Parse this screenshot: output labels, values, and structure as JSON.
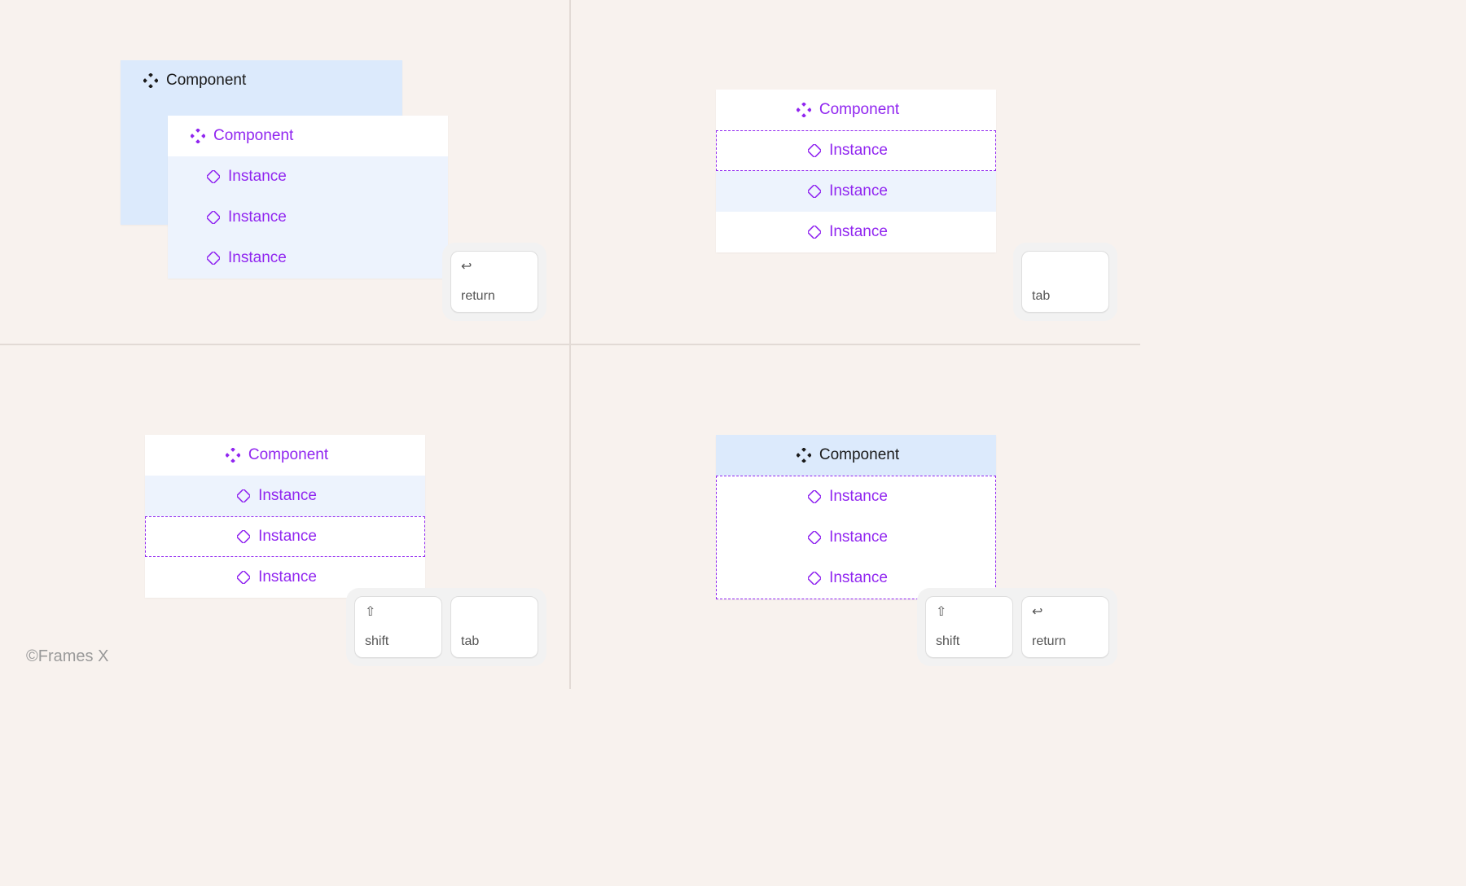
{
  "labels": {
    "component": "Component",
    "instance": "Instance"
  },
  "keys": {
    "return": "return",
    "tab": "tab",
    "shift": "shift"
  },
  "glyphs": {
    "return": "↩",
    "shift": "⇧"
  },
  "panels": {
    "q1": {
      "back": {
        "label_key": "component",
        "style": "black-filled"
      },
      "front": {
        "header": "component",
        "items": [
          "instance",
          "instance",
          "instance"
        ]
      },
      "keys": [
        "return"
      ]
    },
    "q2": {
      "header": "component",
      "items": [
        "instance",
        "instance",
        "instance"
      ],
      "selected_index": 0,
      "highlight_index": 1,
      "keys": [
        "tab"
      ]
    },
    "q3": {
      "header": "component",
      "items": [
        "instance",
        "instance",
        "instance"
      ],
      "selected_index": 1,
      "highlight_index": 0,
      "keys": [
        "shift",
        "tab"
      ]
    },
    "q4": {
      "header": {
        "label_key": "component",
        "style": "black-selected"
      },
      "items": [
        "instance",
        "instance",
        "instance"
      ],
      "items_dashed_box": true,
      "keys": [
        "shift",
        "return"
      ]
    }
  },
  "credit": "©Frames X"
}
